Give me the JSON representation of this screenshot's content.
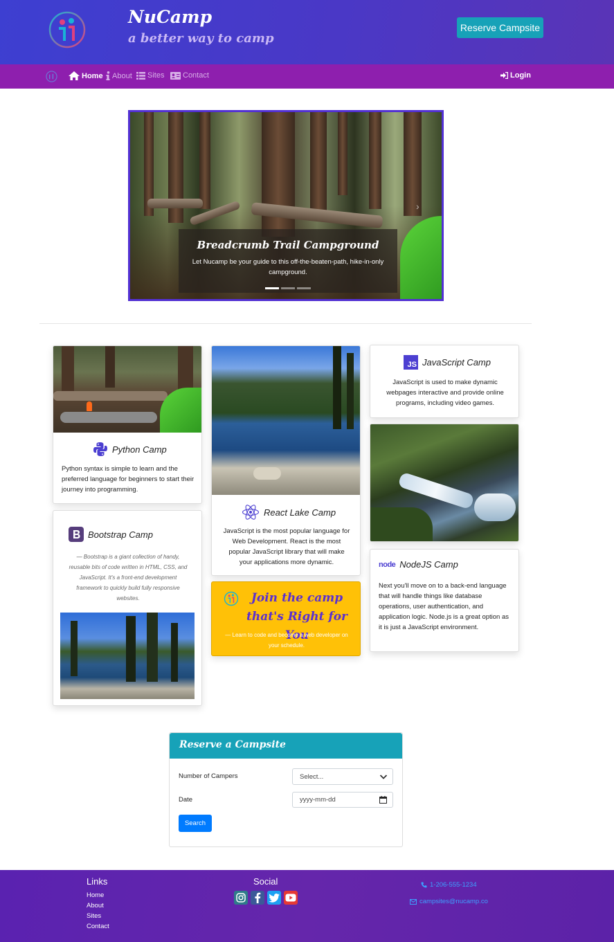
{
  "header": {
    "brand_title": "NuCamp",
    "brand_subtitle": "a better way to camp",
    "reserve_button": "Reserve Campsite"
  },
  "nav": {
    "items": [
      {
        "label": "Home",
        "icon": "home-icon",
        "active": true
      },
      {
        "label": "About",
        "icon": "info-icon",
        "active": false
      },
      {
        "label": "Sites",
        "icon": "list-icon",
        "active": false
      },
      {
        "label": "Contact",
        "icon": "address-card-icon",
        "active": false
      }
    ],
    "login": "Login"
  },
  "carousel": {
    "caption_title": "Breadcrumb Trail Campground",
    "caption_text": "Let Nucamp be your guide to this off-the-beaten-path, hike-in-only campground.",
    "slides": 3,
    "active_slide": 1
  },
  "cards": {
    "python": {
      "title": "Python Camp",
      "text": "Python syntax is simple to learn and the preferred language for beginners to start their journey into programming."
    },
    "bootstrap": {
      "title": "Bootstrap Camp",
      "quote": "— Bootstrap is a giant collection of handy, reusable bits of code written in HTML, CSS, and JavaScript. It's a front-end development framework to quickly build fully responsive websites."
    },
    "react": {
      "title": "React Lake Camp",
      "text": "JavaScript is the most popular language for Web Development. React is the most popular JavaScript library that will make your applications more dynamic."
    },
    "promo": {
      "title": "Join the camp that's Right for You",
      "text": "— Learn to code and become a web developer on your schedule."
    },
    "javascript": {
      "title": "JavaScript Camp",
      "badge": "JS",
      "text": "JavaScript is used to make dynamic webpages interactive and provide online programs, including video games."
    },
    "node": {
      "title": "NodeJS Camp",
      "logo_text": "node",
      "text": "Next you'll move on to a back-end language that will handle things like database operations, user authentication, and application logic. Node.js is a great option as it is just a JavaScript environment."
    }
  },
  "form": {
    "title": "Reserve a Campsite",
    "campers_label": "Number of Campers",
    "campers_value": "Select...",
    "date_label": "Date",
    "date_placeholder": "yyyy-mm-dd",
    "search_button": "Search"
  },
  "footer": {
    "links_heading": "Links",
    "links": [
      "Home",
      "About",
      "Sites",
      "Contact"
    ],
    "social_heading": "Social",
    "social": [
      "instagram-icon",
      "facebook-icon",
      "twitter-icon",
      "youtube-icon"
    ],
    "phone": "1-206-555-1234",
    "email": "campsites@nucamp.co"
  },
  "colors": {
    "header": "#3d3fd1",
    "nav": "#8e1fae",
    "accent": "#17a2b8",
    "promo": "#ffc107",
    "primary": "#007bff"
  }
}
